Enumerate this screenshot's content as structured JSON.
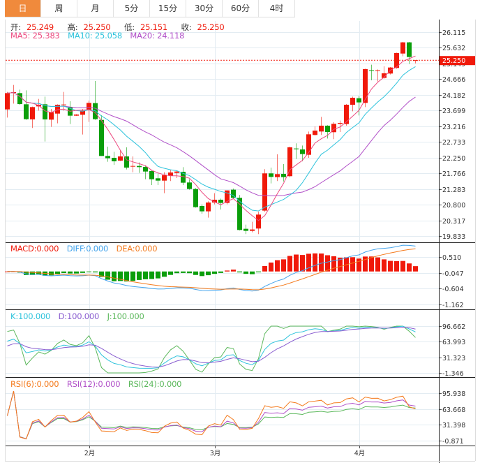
{
  "tabs": [
    "日",
    "周",
    "月",
    "5分",
    "15分",
    "30分",
    "60分",
    "4时"
  ],
  "active_tab": 0,
  "quote": {
    "open_label": "开:",
    "open": "25.249",
    "high_label": "高:",
    "high": "25.250",
    "low_label": "低:",
    "low": "25.151",
    "close_label": "收:",
    "close": "25.250"
  },
  "ma_legend": {
    "ma5": "MA5: 25.383",
    "ma10": "MA10: 25.058",
    "ma20": "MA20: 24.118"
  },
  "macd_legend": {
    "macd": "MACD:0.000",
    "diff": "DIFF:0.000",
    "dea": "DEA:0.000"
  },
  "kdj_legend": {
    "k": "K:100.000",
    "d": "D:100.000",
    "j": "J:100.000"
  },
  "rsi_legend": {
    "rsi6": "RSI(6):0.000",
    "rsi12": "RSI(12):0.000",
    "rsi24": "RSI(24):0.000"
  },
  "colors": {
    "up": "#f0190a",
    "down": "#0a9e0a",
    "tab_active": "#f08a3c",
    "ma5": "#ec4a80",
    "ma10": "#2ec3dc",
    "ma20": "#b150c8",
    "diff": "#44a4ec",
    "dea": "#f47a1c",
    "k": "#2ec3dc",
    "d": "#8a5ed0",
    "j": "#5cb85c",
    "rsi6": "#f47a1c",
    "rsi12": "#b150c8",
    "rsi24": "#5cb85c"
  },
  "chart_data": {
    "type": "candlestick",
    "current_price": "25.250",
    "x_labels": [
      {
        "label": "2月",
        "index": 13
      },
      {
        "label": "3月",
        "index": 33
      },
      {
        "label": "4月",
        "index": 56
      }
    ],
    "ohlc": [
      [
        23.734,
        24.272,
        23.483,
        24.236
      ],
      [
        24.25,
        24.487,
        23.913,
        24.265
      ],
      [
        24.236,
        24.344,
        23.878,
        23.899
      ],
      [
        23.892,
        24.322,
        23.411,
        23.433
      ],
      [
        23.426,
        23.82,
        23.161,
        23.806
      ],
      [
        23.827,
        24.057,
        23.698,
        23.878
      ],
      [
        23.892,
        24.128,
        22.745,
        23.426
      ],
      [
        23.419,
        23.749,
        23.196,
        23.648
      ],
      [
        23.605,
        23.892,
        23.304,
        23.878
      ],
      [
        23.863,
        24.272,
        23.698,
        23.885
      ],
      [
        23.806,
        23.985,
        23.282,
        23.541
      ],
      [
        23.541,
        23.591,
        23.533,
        23.576
      ],
      [
        23.569,
        23.749,
        22.96,
        23.698
      ],
      [
        23.72,
        24.007,
        23.347,
        23.935
      ],
      [
        23.928,
        24.609,
        23.411,
        23.433
      ],
      [
        23.411,
        23.555,
        22.3,
        22.3
      ],
      [
        22.3,
        22.587,
        22.121,
        22.229
      ],
      [
        22.243,
        22.429,
        22.028,
        22.135
      ],
      [
        22.157,
        22.479,
        22.142,
        22.286
      ],
      [
        22.286,
        22.565,
        21.884,
        21.942
      ],
      [
        21.977,
        22.286,
        21.798,
        21.992
      ],
      [
        21.992,
        22.099,
        21.777,
        21.956
      ],
      [
        21.963,
        22.013,
        21.583,
        21.82
      ],
      [
        21.834,
        21.856,
        21.404,
        21.583
      ],
      [
        21.612,
        21.762,
        21.404,
        21.54
      ],
      [
        21.54,
        21.798,
        21.153,
        21.705
      ],
      [
        21.691,
        21.87,
        21.526,
        21.791
      ],
      [
        21.777,
        21.856,
        21.619,
        21.82
      ],
      [
        21.813,
        21.956,
        21.404,
        21.476
      ],
      [
        21.483,
        21.583,
        21.261,
        21.282
      ],
      [
        21.282,
        21.311,
        20.708,
        20.723
      ],
      [
        20.759,
        20.809,
        20.522,
        20.594
      ],
      [
        20.594,
        20.902,
        20.4,
        20.866
      ],
      [
        20.866,
        21.153,
        20.809,
        20.952
      ],
      [
        20.952,
        20.988,
        20.651,
        20.852
      ],
      [
        20.852,
        21.239,
        20.809,
        21.239
      ],
      [
        21.261,
        21.297,
        20.974,
        21.01
      ],
      [
        21.01,
        21.096,
        20.006,
        20.02
      ],
      [
        20.056,
        20.185,
        19.891,
        19.992
      ],
      [
        19.992,
        20.271,
        19.949,
        20.035
      ],
      [
        20.064,
        20.58,
        19.891,
        20.494
      ],
      [
        20.616,
        21.892,
        20.58,
        21.763
      ],
      [
        21.763,
        21.942,
        21.455,
        21.655
      ],
      [
        21.648,
        22.351,
        21.526,
        21.741
      ],
      [
        21.748,
        22.05,
        21.512,
        21.648
      ],
      [
        21.677,
        22.587,
        21.641,
        22.566
      ],
      [
        22.53,
        22.688,
        22.207,
        22.509
      ],
      [
        22.501,
        22.623,
        22.136,
        22.358
      ],
      [
        22.336,
        23.053,
        22.243,
        22.967
      ],
      [
        22.946,
        23.211,
        22.931,
        23.082
      ],
      [
        23.053,
        23.505,
        22.946,
        23.233
      ],
      [
        23.233,
        23.247,
        22.838,
        23.039
      ],
      [
        23.032,
        23.34,
        22.817,
        23.29
      ],
      [
        23.29,
        23.39,
        23.039,
        23.319
      ],
      [
        23.283,
        23.9,
        23.233,
        23.878
      ],
      [
        23.878,
        24.129,
        23.677,
        24.093
      ],
      [
        24.079,
        24.15,
        23.548,
        23.95
      ],
      [
        23.935,
        24.989,
        23.806,
        24.975
      ],
      [
        24.939,
        25.111,
        24.631,
        24.918
      ],
      [
        24.918,
        24.968,
        24.595,
        24.939
      ],
      [
        24.703,
        25.061,
        24.681,
        24.846
      ],
      [
        24.839,
        25.04,
        24.81,
        25.025
      ],
      [
        25.011,
        25.484,
        24.989,
        25.47
      ],
      [
        25.455,
        25.814,
        25.369,
        25.8
      ],
      [
        25.8,
        25.814,
        25.133,
        25.348
      ],
      [
        25.249,
        25.25,
        25.151,
        25.25
      ]
    ],
    "price_ticks": [
      "26.115",
      "25.632",
      "25.149",
      "24.666",
      "24.182",
      "23.699",
      "23.216",
      "22.733",
      "22.250",
      "21.766",
      "21.283",
      "20.800",
      "20.317",
      "19.833"
    ],
    "macd_ticks": [
      "0.510",
      "-0.047",
      "-0.604",
      "-1.162"
    ],
    "kdj_ticks": [
      "96.662",
      "63.993",
      "31.323",
      "-1.346"
    ],
    "rsi_ticks": [
      "95.938",
      "63.668",
      "31.398",
      "-0.871"
    ],
    "grid": true
  }
}
